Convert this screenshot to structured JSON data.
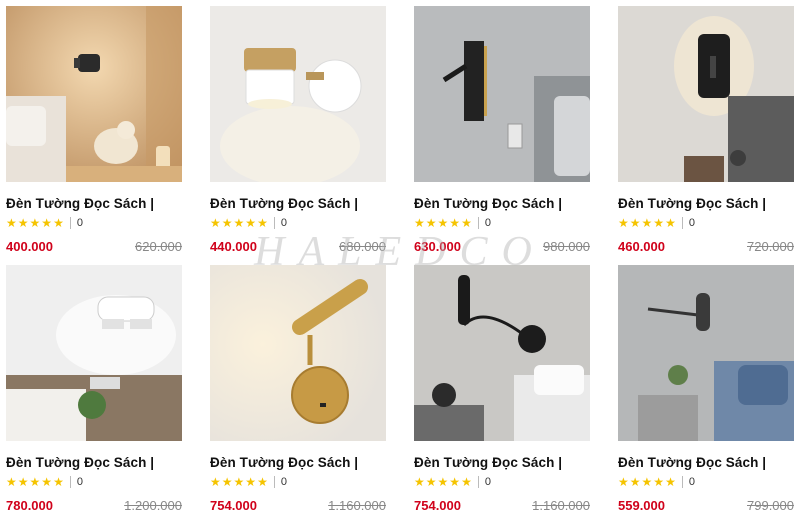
{
  "products": [
    {
      "title": "Đèn Tường Đọc Sách |",
      "rating_count": "0",
      "price": "400.000",
      "old_price": "620.000",
      "stars": 5
    },
    {
      "title": "Đèn Tường Đọc Sách |",
      "rating_count": "0",
      "price": "440.000",
      "old_price": "680.000",
      "stars": 5
    },
    {
      "title": "Đèn Tường Đọc Sách |",
      "rating_count": "0",
      "price": "630.000",
      "old_price": "980.000",
      "stars": 5
    },
    {
      "title": "Đèn Tường Đọc Sách |",
      "rating_count": "0",
      "price": "460.000",
      "old_price": "720.000",
      "stars": 5
    },
    {
      "title": "Đèn Tường Đọc Sách |",
      "rating_count": "0",
      "price": "780.000",
      "old_price": "1.200.000",
      "stars": 5
    },
    {
      "title": "Đèn Tường Đọc Sách |",
      "rating_count": "0",
      "price": "754.000",
      "old_price": "1.160.000",
      "stars": 5
    },
    {
      "title": "Đèn Tường Đọc Sách |",
      "rating_count": "0",
      "price": "754.000",
      "old_price": "1.160.000",
      "stars": 5
    },
    {
      "title": "Đèn Tường Đọc Sách |",
      "rating_count": "0",
      "price": "559.000",
      "old_price": "799.000",
      "stars": 5
    }
  ],
  "watermark": "HALEDCO",
  "colors": {
    "price": "#d0021b",
    "star": "#f5c400",
    "old_price": "#888888"
  }
}
